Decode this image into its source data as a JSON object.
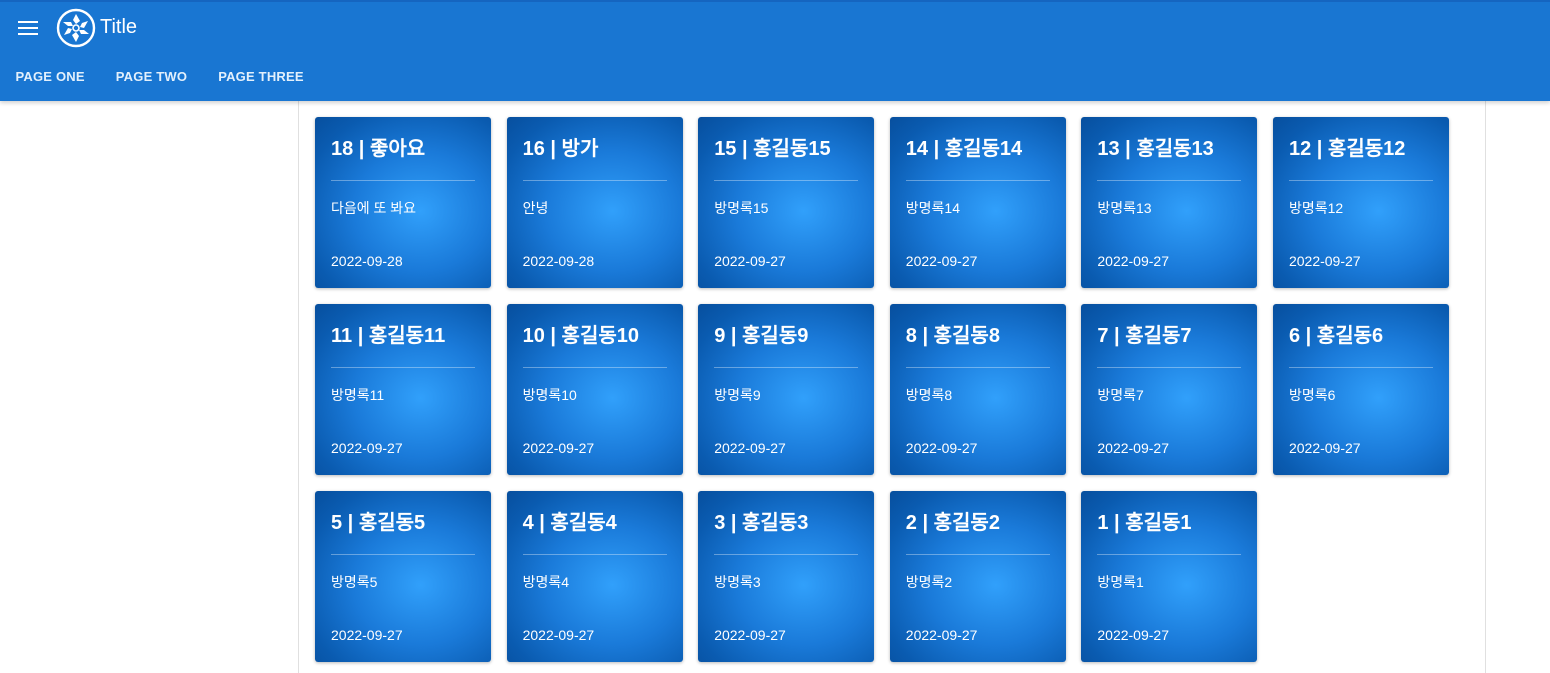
{
  "app": {
    "title": "Title",
    "menu_icon": "menu-icon",
    "logo_icon": "logo-icon",
    "header_color": "#1976d2"
  },
  "tabs": [
    {
      "label": "PAGE ONE"
    },
    {
      "label": "PAGE TWO"
    },
    {
      "label": "PAGE THREE"
    }
  ],
  "cards": [
    {
      "title": "18 | 좋아요",
      "body": "다음에 또 봐요",
      "date": "2022-09-28"
    },
    {
      "title": "16 | 방가",
      "body": "안녕",
      "date": "2022-09-28"
    },
    {
      "title": "15 | 홍길동15",
      "body": "방명록15",
      "date": "2022-09-27"
    },
    {
      "title": "14 | 홍길동14",
      "body": "방명록14",
      "date": "2022-09-27"
    },
    {
      "title": "13 | 홍길동13",
      "body": "방명록13",
      "date": "2022-09-27"
    },
    {
      "title": "12 | 홍길동12",
      "body": "방명록12",
      "date": "2022-09-27"
    },
    {
      "title": "11 | 홍길동11",
      "body": "방명록11",
      "date": "2022-09-27"
    },
    {
      "title": "10 | 홍길동10",
      "body": "방명록10",
      "date": "2022-09-27"
    },
    {
      "title": "9 | 홍길동9",
      "body": "방명록9",
      "date": "2022-09-27"
    },
    {
      "title": "8 | 홍길동8",
      "body": "방명록8",
      "date": "2022-09-27"
    },
    {
      "title": "7 | 홍길동7",
      "body": "방명록7",
      "date": "2022-09-27"
    },
    {
      "title": "6 | 홍길동6",
      "body": "방명록6",
      "date": "2022-09-27"
    },
    {
      "title": "5 | 홍길동5",
      "body": "방명록5",
      "date": "2022-09-27"
    },
    {
      "title": "4 | 홍길동4",
      "body": "방명록4",
      "date": "2022-09-27"
    },
    {
      "title": "3 | 홍길동3",
      "body": "방명록3",
      "date": "2022-09-27"
    },
    {
      "title": "2 | 홍길동2",
      "body": "방명록2",
      "date": "2022-09-27"
    },
    {
      "title": "1 | 홍길동1",
      "body": "방명록1",
      "date": "2022-09-27"
    }
  ]
}
